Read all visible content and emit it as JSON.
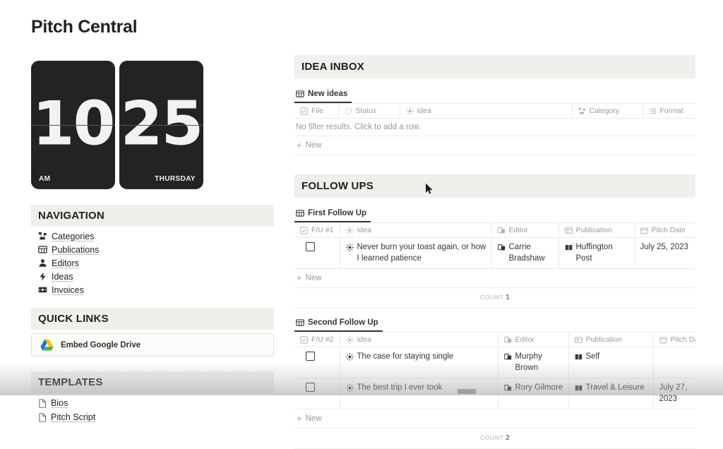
{
  "page": {
    "title": "Pitch Central"
  },
  "clock": {
    "hour": "10",
    "minute": "25",
    "meridiem": "AM",
    "weekday": "THURSDAY"
  },
  "sidebar": {
    "navigation": {
      "heading": "NAVIGATION",
      "items": [
        {
          "label": "Categories",
          "icon": "relation-icon"
        },
        {
          "label": "Publications",
          "icon": "table-icon"
        },
        {
          "label": "Editors",
          "icon": "person-icon"
        },
        {
          "label": "Ideas",
          "icon": "bolt-icon"
        },
        {
          "label": "Invoices",
          "icon": "money-icon"
        }
      ]
    },
    "quick_links": {
      "heading": "QUICK LINKS",
      "items": [
        {
          "label": "Embed Google Drive",
          "icon": "google-drive-icon"
        }
      ]
    },
    "templates": {
      "heading": "TEMPLATES",
      "items": [
        {
          "label": "Bios",
          "icon": "page-icon"
        },
        {
          "label": "Pitch Script",
          "icon": "page-icon"
        }
      ]
    }
  },
  "main": {
    "idea_inbox": {
      "heading": "IDEA INBOX",
      "tab": {
        "label": "New ideas",
        "icon": "table-icon"
      },
      "columns": [
        {
          "label": "File",
          "icon": "checkbox-icon"
        },
        {
          "label": "Status",
          "icon": "status-icon"
        },
        {
          "label": "Idea",
          "icon": "sun-icon"
        },
        {
          "label": "Category",
          "icon": "relation-icon"
        },
        {
          "label": "Format",
          "icon": "list-icon"
        }
      ],
      "empty_message": "No filter results. Click to add a row.",
      "new_row_label": "New"
    },
    "follow_ups": {
      "heading": "FOLLOW UPS",
      "first": {
        "tab": {
          "label": "First Follow Up",
          "icon": "table-icon"
        },
        "columns": [
          {
            "label": "F/U #1",
            "icon": "checkbox-icon"
          },
          {
            "label": "Idea",
            "icon": "sun-icon"
          },
          {
            "label": "Editor",
            "icon": "relation-page-icon"
          },
          {
            "label": "Publication",
            "icon": "table-icon"
          },
          {
            "label": "Pitch Date",
            "icon": "calendar-icon"
          }
        ],
        "rows": [
          {
            "checked": false,
            "idea": "Never burn your toast again, or how I learned patience",
            "editor": "Carrie Bradshaw",
            "publication": "Huffington Post",
            "pitch_date": "July 25, 2023"
          }
        ],
        "new_row_label": "New",
        "count_label": "COUNT",
        "count_value": "1"
      },
      "second": {
        "tab": {
          "label": "Second Follow Up",
          "icon": "table-icon"
        },
        "columns": [
          {
            "label": "F/U #2",
            "icon": "checkbox-icon"
          },
          {
            "label": "Idea",
            "icon": "sun-icon"
          },
          {
            "label": "Editor",
            "icon": "relation-page-icon"
          },
          {
            "label": "Publication",
            "icon": "table-icon"
          },
          {
            "label": "Pitch Date",
            "icon": "calendar-icon"
          }
        ],
        "rows": [
          {
            "checked": false,
            "idea": "The case for staying single",
            "editor": "Murphy Brown",
            "publication": "Self",
            "pitch_date": ""
          },
          {
            "checked": false,
            "idea": "The best trip I ever took",
            "editor": "Rory Gilmore",
            "publication": "Travel & Leisure",
            "pitch_date": "July 27, 2023"
          }
        ],
        "new_row_label": "New",
        "count_label": "COUNT",
        "count_value": "2"
      }
    }
  },
  "colors": {
    "section_bar_bg": "#f0efec",
    "clock_bg": "#232323",
    "text": "#37352f",
    "muted": "#9b9a97"
  }
}
